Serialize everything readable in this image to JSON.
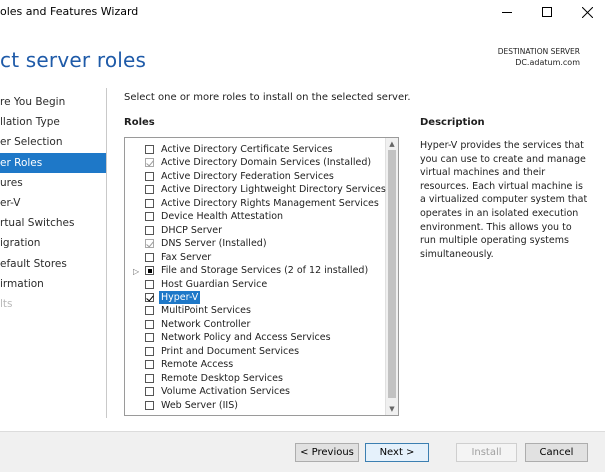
{
  "window": {
    "title": "oles and Features Wizard"
  },
  "header": {
    "page_title": "ct server roles",
    "destination_label": "DESTINATION SERVER",
    "destination_server": "DC.adatum.com"
  },
  "nav": {
    "items": [
      {
        "label": "re You Begin",
        "state": "normal"
      },
      {
        "label": "llation Type",
        "state": "normal"
      },
      {
        "label": "er Selection",
        "state": "normal"
      },
      {
        "label": "er Roles",
        "state": "active"
      },
      {
        "label": "ures",
        "state": "normal"
      },
      {
        "label": "er-V",
        "state": "normal"
      },
      {
        "label": "rtual Switches",
        "state": "normal"
      },
      {
        "label": "igration",
        "state": "normal"
      },
      {
        "label": "efault Stores",
        "state": "normal"
      },
      {
        "label": "irmation",
        "state": "normal"
      },
      {
        "label": "lts",
        "state": "disabled"
      }
    ]
  },
  "main": {
    "instruction": "Select one or more roles to install on the selected server.",
    "roles_heading": "Roles",
    "description_heading": "Description",
    "description_text": "Hyper-V provides the services that you can use to create and manage virtual machines and their resources. Each virtual machine is a virtualized computer system that operates in an isolated execution environment. This allows you to run multiple operating systems simultaneously."
  },
  "roles": [
    {
      "label": "Active Directory Certificate Services",
      "checked": false,
      "disabled": false
    },
    {
      "label": "Active Directory Domain Services (Installed)",
      "checked": true,
      "disabled": true
    },
    {
      "label": "Active Directory Federation Services",
      "checked": false,
      "disabled": false
    },
    {
      "label": "Active Directory Lightweight Directory Services",
      "checked": false,
      "disabled": false
    },
    {
      "label": "Active Directory Rights Management Services",
      "checked": false,
      "disabled": false
    },
    {
      "label": "Device Health Attestation",
      "checked": false,
      "disabled": false
    },
    {
      "label": "DHCP Server",
      "checked": false,
      "disabled": false
    },
    {
      "label": "DNS Server (Installed)",
      "checked": true,
      "disabled": true
    },
    {
      "label": "Fax Server",
      "checked": false,
      "disabled": false
    },
    {
      "label": "File and Storage Services (2 of 12 installed)",
      "checked": false,
      "partial": true,
      "expandable": true
    },
    {
      "label": "Host Guardian Service",
      "checked": false,
      "disabled": false
    },
    {
      "label": "Hyper-V",
      "checked": true,
      "selected": true
    },
    {
      "label": "MultiPoint Services",
      "checked": false
    },
    {
      "label": "Network Controller",
      "checked": false
    },
    {
      "label": "Network Policy and Access Services",
      "checked": false
    },
    {
      "label": "Print and Document Services",
      "checked": false
    },
    {
      "label": "Remote Access",
      "checked": false
    },
    {
      "label": "Remote Desktop Services",
      "checked": false
    },
    {
      "label": "Volume Activation Services",
      "checked": false
    },
    {
      "label": "Web Server (IIS)",
      "checked": false
    }
  ],
  "footer": {
    "previous_label": "< Previous",
    "next_label": "Next >",
    "install_label": "Install",
    "cancel_label": "Cancel"
  },
  "colors": {
    "accent": "#1e78c8",
    "title_blue": "#1e5aa8"
  }
}
